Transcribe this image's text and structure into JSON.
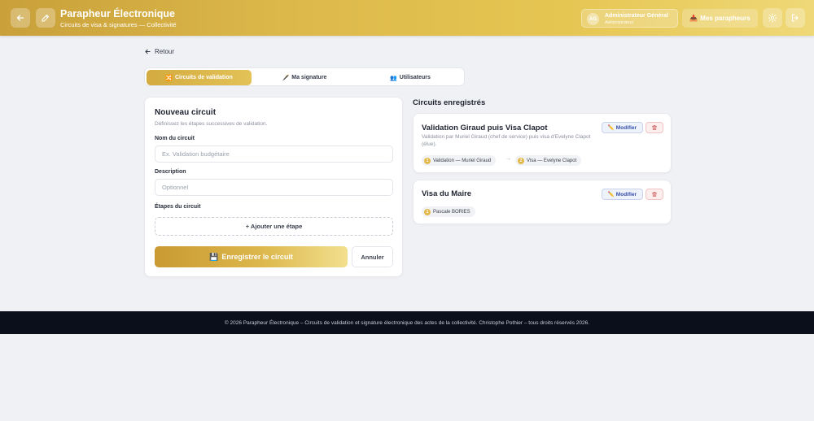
{
  "header": {
    "title": "Parapheur Électronique",
    "subtitle": "Circuits de visa & signatures — Collectivité",
    "user_initials": "AG",
    "user_name": "Administrateur Général",
    "user_role": "Administrateur",
    "my_button_label": "Mes parapheurs",
    "my_button_icon": "📥"
  },
  "nav": {
    "back_label": "Retour"
  },
  "tabs": [
    {
      "icon": "🔀",
      "label": "Circuits de validation",
      "active": true
    },
    {
      "icon": "🖋️",
      "label": "Ma signature",
      "active": false
    },
    {
      "icon": "👥",
      "label": "Utilisateurs",
      "active": false
    }
  ],
  "form": {
    "title": "Nouveau circuit",
    "description": "Définissez les étapes successives de validation.",
    "name_label": "Nom du circuit",
    "name_placeholder": "Ex. Validation budgétaire",
    "name_value": "",
    "desc_label": "Description",
    "desc_placeholder": "Optionnel",
    "desc_value": "",
    "steps_label": "Étapes du circuit",
    "add_step_label": "+ Ajouter une étape",
    "save_icon": "💾",
    "save_label": "Enregistrer le circuit",
    "cancel_label": "Annuler"
  },
  "circuits": {
    "title": "Circuits enregistrés",
    "edit_label": "✏️ Modifier",
    "items": [
      {
        "name": "Validation Giraud puis Visa Clapot",
        "description": "Validation par Muriel Giraud (chef de service) puis visa d'Evelyne Clapot (élue).",
        "steps": [
          {
            "num": "1",
            "label": "Validation — Muriel Giraud"
          },
          {
            "num": "2",
            "label": "Visa — Evelyne Clapot"
          }
        ],
        "arrow": "→"
      },
      {
        "name": "Visa du Maire",
        "description": "",
        "steps": [
          {
            "num": "1",
            "label": "Pascale BORIES"
          }
        ]
      }
    ]
  },
  "footer": {
    "text": "© 2026 Parapheur Électronique – Circuits de validation et signature électronique des actes de la collectivité. Christophe Pothier – tous droits réservés 2026."
  },
  "colors": {
    "accent": "#dcb84a",
    "footer_bg": "#0b0f1c",
    "edit_text": "#3650a8",
    "delete_tint": "#fdeeee"
  }
}
